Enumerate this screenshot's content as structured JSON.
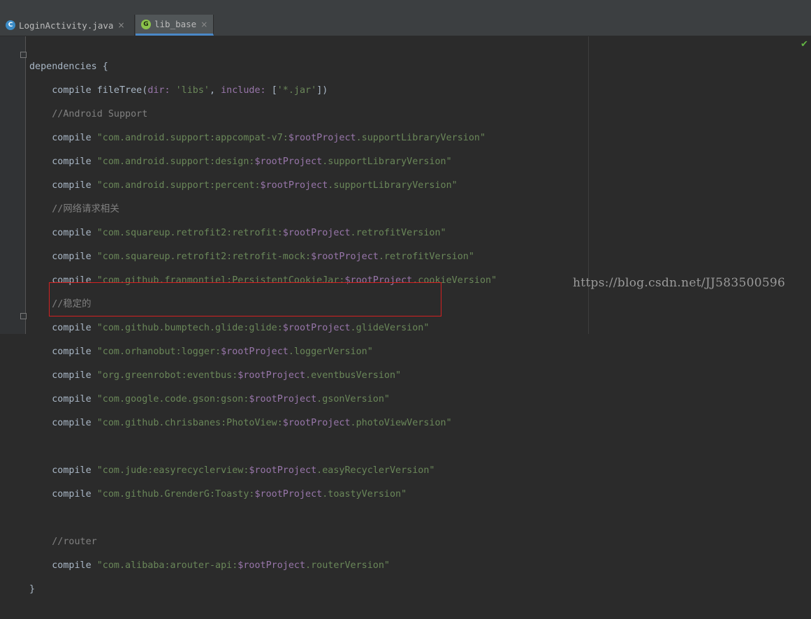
{
  "tabs": [
    {
      "label": "LoginActivity.java",
      "icon": "java-class-icon",
      "close": "×",
      "icon_glyph": "C"
    },
    {
      "label": "lib_base",
      "icon": "gradle-icon",
      "close": "×",
      "icon_glyph": "G",
      "active": true
    }
  ],
  "status": {
    "check": "✔"
  },
  "code": {
    "l1": {
      "a": "dependencies {"
    },
    "l2": {
      "a": "compile fileTree(",
      "b": "dir: ",
      "c": "'libs'",
      "d": ", ",
      "e": "include: ",
      "f": "[",
      "g": "'*.jar'",
      "h": "])"
    },
    "l3": {
      "a": "//Android Support"
    },
    "l4": {
      "a": "compile ",
      "b": "\"com.android.support:appcompat-v7:",
      "c": "$rootProject",
      "d": ".supportLibraryVersion\""
    },
    "l5": {
      "a": "compile ",
      "b": "\"com.android.support:design:",
      "c": "$rootProject",
      "d": ".supportLibraryVersion\""
    },
    "l6": {
      "a": "compile ",
      "b": "\"com.android.support:percent:",
      "c": "$rootProject",
      "d": ".supportLibraryVersion\""
    },
    "l7": {
      "a": "//网络请求相关"
    },
    "l8": {
      "a": "compile ",
      "b": "\"com.squareup.retrofit2:retrofit:",
      "c": "$rootProject",
      "d": ".retrofitVersion\""
    },
    "l9": {
      "a": "compile ",
      "b": "\"com.squareup.retrofit2:retrofit-mock:",
      "c": "$rootProject",
      "d": ".retrofitVersion\""
    },
    "l10": {
      "a": "compile ",
      "b": "\"com.github.franmontiel:PersistentCookieJar:",
      "c": "$rootProject",
      "d": ".cookieVersion\""
    },
    "l11": {
      "a": "//稳定的"
    },
    "l12": {
      "a": "compile ",
      "b": "\"com.github.bumptech.glide:glide:",
      "c": "$rootProject",
      "d": ".glideVersion\""
    },
    "l13": {
      "a": "compile ",
      "b": "\"com.orhanobut:logger:",
      "c": "$rootProject",
      "d": ".loggerVersion\""
    },
    "l14": {
      "a": "compile ",
      "b": "\"org.greenrobot:eventbus:",
      "c": "$rootProject",
      "d": ".eventbusVersion\""
    },
    "l15": {
      "a": "compile ",
      "b": "\"com.google.code.gson:gson:",
      "c": "$rootProject",
      "d": ".gsonVersion\""
    },
    "l16": {
      "a": "compile ",
      "b": "\"com.github.chrisbanes:PhotoView:",
      "c": "$rootProject",
      "d": ".photoViewVersion\""
    },
    "l18": {
      "a": "compile ",
      "b": "\"com.jude:easyrecyclerview:",
      "c": "$rootProject",
      "d": ".easyRecyclerVersion\""
    },
    "l19": {
      "a": "compile ",
      "b": "\"com.github.GrenderG:Toasty:",
      "c": "$rootProject",
      "d": ".toastyVersion\""
    },
    "l21": {
      "a": "//router"
    },
    "l22": {
      "a": "compile ",
      "b": "\"com.alibaba:arouter-api:",
      "c": "$rootProject",
      "d": ".routerVersion\""
    },
    "l23": {
      "a": "}"
    }
  },
  "watermark": "https://blog.csdn.net/JJ583500596",
  "colors": {
    "keyword": "#a9b7c6",
    "string": "#6a8759",
    "variable": "#9876aa",
    "comment": "#808080",
    "highlight_box": "#d42121"
  }
}
